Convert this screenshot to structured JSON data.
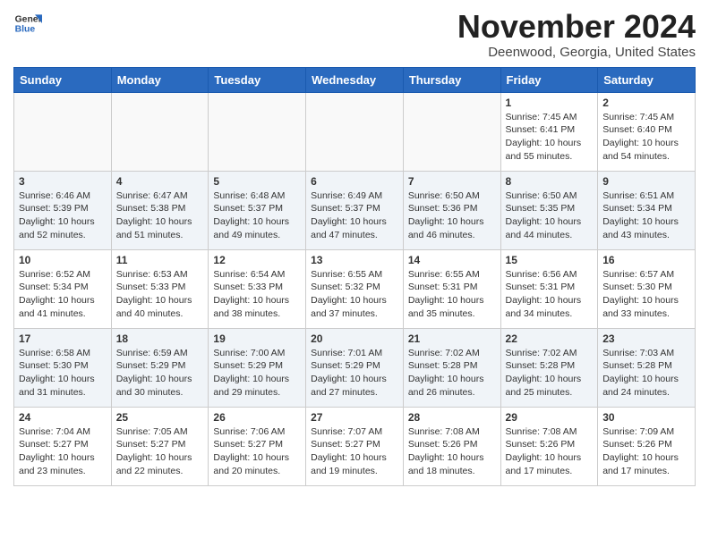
{
  "header": {
    "logo_line1": "General",
    "logo_line2": "Blue",
    "month": "November 2024",
    "location": "Deenwood, Georgia, United States"
  },
  "days_of_week": [
    "Sunday",
    "Monday",
    "Tuesday",
    "Wednesday",
    "Thursday",
    "Friday",
    "Saturday"
  ],
  "weeks": [
    [
      {
        "day": "",
        "empty": true
      },
      {
        "day": "",
        "empty": true
      },
      {
        "day": "",
        "empty": true
      },
      {
        "day": "",
        "empty": true
      },
      {
        "day": "",
        "empty": true
      },
      {
        "day": "1",
        "sunrise": "7:45 AM",
        "sunset": "6:41 PM",
        "daylight": "10 hours and 55 minutes."
      },
      {
        "day": "2",
        "sunrise": "7:45 AM",
        "sunset": "6:40 PM",
        "daylight": "10 hours and 54 minutes."
      }
    ],
    [
      {
        "day": "3",
        "sunrise": "6:46 AM",
        "sunset": "5:39 PM",
        "daylight": "10 hours and 52 minutes."
      },
      {
        "day": "4",
        "sunrise": "6:47 AM",
        "sunset": "5:38 PM",
        "daylight": "10 hours and 51 minutes."
      },
      {
        "day": "5",
        "sunrise": "6:48 AM",
        "sunset": "5:37 PM",
        "daylight": "10 hours and 49 minutes."
      },
      {
        "day": "6",
        "sunrise": "6:49 AM",
        "sunset": "5:37 PM",
        "daylight": "10 hours and 47 minutes."
      },
      {
        "day": "7",
        "sunrise": "6:50 AM",
        "sunset": "5:36 PM",
        "daylight": "10 hours and 46 minutes."
      },
      {
        "day": "8",
        "sunrise": "6:50 AM",
        "sunset": "5:35 PM",
        "daylight": "10 hours and 44 minutes."
      },
      {
        "day": "9",
        "sunrise": "6:51 AM",
        "sunset": "5:34 PM",
        "daylight": "10 hours and 43 minutes."
      }
    ],
    [
      {
        "day": "10",
        "sunrise": "6:52 AM",
        "sunset": "5:34 PM",
        "daylight": "10 hours and 41 minutes."
      },
      {
        "day": "11",
        "sunrise": "6:53 AM",
        "sunset": "5:33 PM",
        "daylight": "10 hours and 40 minutes."
      },
      {
        "day": "12",
        "sunrise": "6:54 AM",
        "sunset": "5:33 PM",
        "daylight": "10 hours and 38 minutes."
      },
      {
        "day": "13",
        "sunrise": "6:55 AM",
        "sunset": "5:32 PM",
        "daylight": "10 hours and 37 minutes."
      },
      {
        "day": "14",
        "sunrise": "6:55 AM",
        "sunset": "5:31 PM",
        "daylight": "10 hours and 35 minutes."
      },
      {
        "day": "15",
        "sunrise": "6:56 AM",
        "sunset": "5:31 PM",
        "daylight": "10 hours and 34 minutes."
      },
      {
        "day": "16",
        "sunrise": "6:57 AM",
        "sunset": "5:30 PM",
        "daylight": "10 hours and 33 minutes."
      }
    ],
    [
      {
        "day": "17",
        "sunrise": "6:58 AM",
        "sunset": "5:30 PM",
        "daylight": "10 hours and 31 minutes."
      },
      {
        "day": "18",
        "sunrise": "6:59 AM",
        "sunset": "5:29 PM",
        "daylight": "10 hours and 30 minutes."
      },
      {
        "day": "19",
        "sunrise": "7:00 AM",
        "sunset": "5:29 PM",
        "daylight": "10 hours and 29 minutes."
      },
      {
        "day": "20",
        "sunrise": "7:01 AM",
        "sunset": "5:29 PM",
        "daylight": "10 hours and 27 minutes."
      },
      {
        "day": "21",
        "sunrise": "7:02 AM",
        "sunset": "5:28 PM",
        "daylight": "10 hours and 26 minutes."
      },
      {
        "day": "22",
        "sunrise": "7:02 AM",
        "sunset": "5:28 PM",
        "daylight": "10 hours and 25 minutes."
      },
      {
        "day": "23",
        "sunrise": "7:03 AM",
        "sunset": "5:28 PM",
        "daylight": "10 hours and 24 minutes."
      }
    ],
    [
      {
        "day": "24",
        "sunrise": "7:04 AM",
        "sunset": "5:27 PM",
        "daylight": "10 hours and 23 minutes."
      },
      {
        "day": "25",
        "sunrise": "7:05 AM",
        "sunset": "5:27 PM",
        "daylight": "10 hours and 22 minutes."
      },
      {
        "day": "26",
        "sunrise": "7:06 AM",
        "sunset": "5:27 PM",
        "daylight": "10 hours and 20 minutes."
      },
      {
        "day": "27",
        "sunrise": "7:07 AM",
        "sunset": "5:27 PM",
        "daylight": "10 hours and 19 minutes."
      },
      {
        "day": "28",
        "sunrise": "7:08 AM",
        "sunset": "5:26 PM",
        "daylight": "10 hours and 18 minutes."
      },
      {
        "day": "29",
        "sunrise": "7:08 AM",
        "sunset": "5:26 PM",
        "daylight": "10 hours and 17 minutes."
      },
      {
        "day": "30",
        "sunrise": "7:09 AM",
        "sunset": "5:26 PM",
        "daylight": "10 hours and 17 minutes."
      }
    ]
  ],
  "labels": {
    "sunrise": "Sunrise:",
    "sunset": "Sunset:",
    "daylight": "Daylight:"
  }
}
